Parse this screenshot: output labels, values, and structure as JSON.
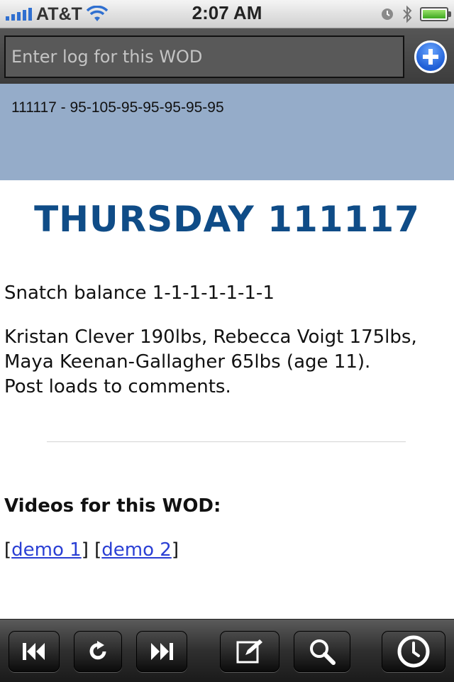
{
  "status_bar": {
    "carrier": "AT&T",
    "time": "2:07 AM",
    "signal_bars": 5,
    "battery_level": 1.0
  },
  "log_input": {
    "placeholder": "Enter log for this WOD",
    "value": ""
  },
  "log_entries": [
    "111117 - 95-105-95-95-95-95-95"
  ],
  "wod": {
    "title": "THURSDAY 111117",
    "workout": "Snatch balance 1-1-1-1-1-1-1",
    "notes": "Kristan Clever 190lbs, Rebecca Voigt 175lbs, Maya Keenan-Gallagher 65lbs (age 11).",
    "post": "Post loads to comments.",
    "videos_heading": "Videos for this WOD:",
    "video_links": [
      "demo 1",
      "demo 2"
    ]
  },
  "toolbar": {
    "buttons": [
      "rewind-icon",
      "refresh-icon",
      "fast-forward-icon",
      "compose-icon",
      "search-icon",
      "clock-icon"
    ]
  },
  "colors": {
    "title": "#0f4c87",
    "log_area": "#95acc9",
    "link": "#2a3fd4",
    "add_button": "#1f5fd6"
  }
}
